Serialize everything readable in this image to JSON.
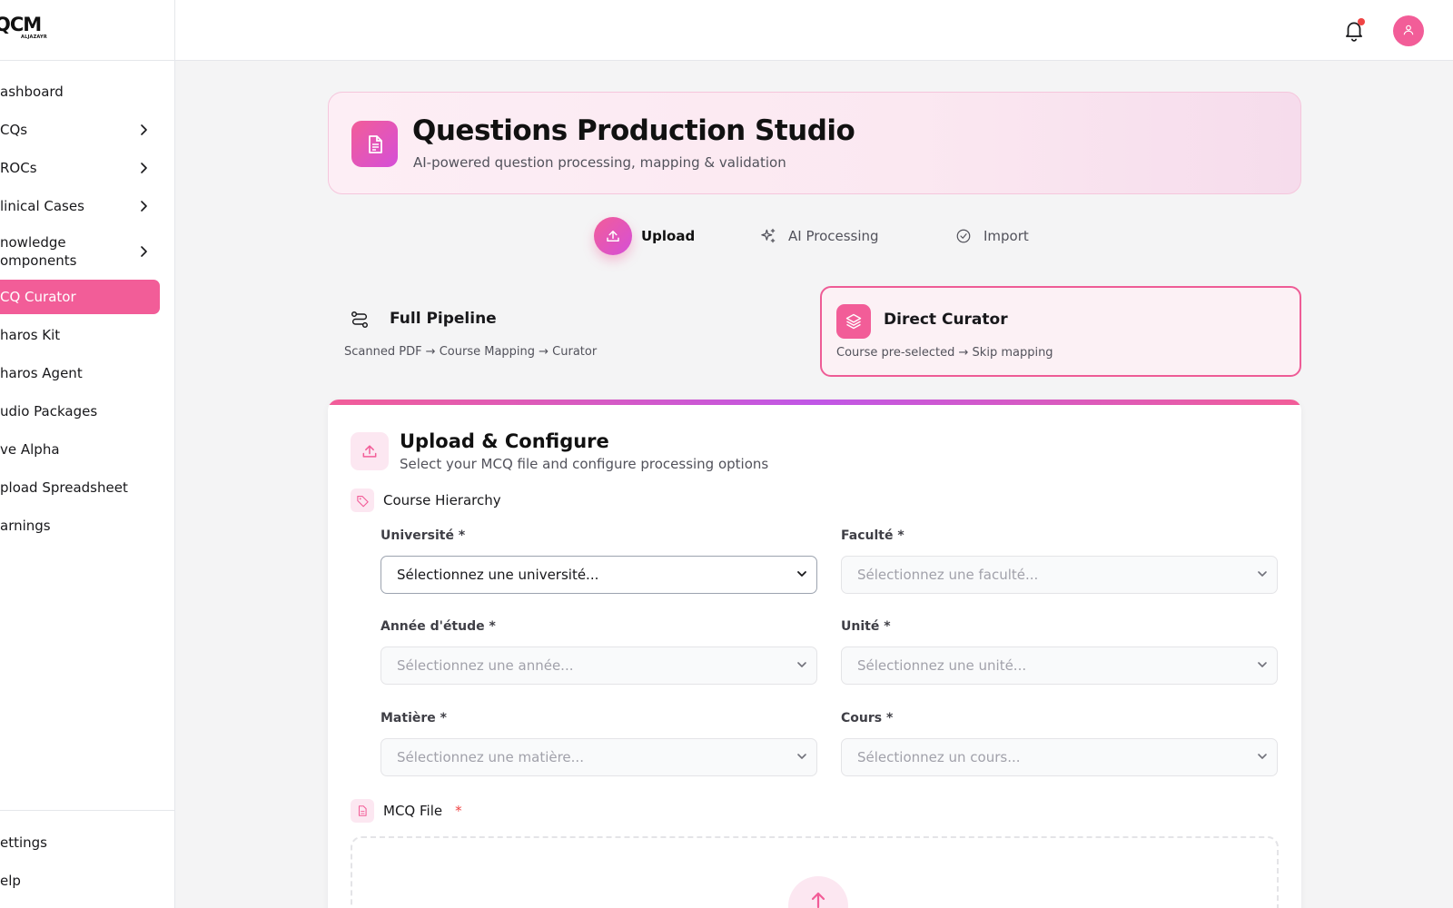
{
  "logo": {
    "main": "QCM",
    "sub": "ALJAZAYR"
  },
  "sidebar": {
    "items": [
      {
        "label": "ashboard",
        "chevron": false
      },
      {
        "label": "CQs",
        "chevron": true
      },
      {
        "label": "ROCs",
        "chevron": true
      },
      {
        "label": "linical Cases",
        "chevron": true
      },
      {
        "label": "nowledge\nomponents",
        "chevron": true
      },
      {
        "label": "CQ Curator",
        "chevron": false,
        "active": true
      },
      {
        "label": "haros Kit",
        "chevron": false
      },
      {
        "label": "haros Agent",
        "chevron": false
      },
      {
        "label": "udio Packages",
        "chevron": false
      },
      {
        "label": "ve Alpha",
        "chevron": false
      },
      {
        "label": "pload Spreadsheet",
        "chevron": false
      },
      {
        "label": "arnings",
        "chevron": false
      }
    ],
    "bottom": [
      {
        "label": "ettings"
      },
      {
        "label": "elp"
      }
    ]
  },
  "topbar": {
    "bell_icon": "bell-icon",
    "avatar_icon": "user-icon"
  },
  "header": {
    "title": "Questions Production Studio",
    "subtitle": "AI-powered question processing, mapping & validation",
    "icon": "document-icon"
  },
  "stepper": [
    {
      "label": "Upload",
      "icon": "upload-icon",
      "active": true
    },
    {
      "label": "AI Processing",
      "icon": "sparkles-icon",
      "active": false
    },
    {
      "label": "Import",
      "icon": "check-circle-icon",
      "active": false
    }
  ],
  "modes": {
    "full": {
      "title": "Full Pipeline",
      "desc": "Scanned PDF → Course Mapping → Curator",
      "icon": "workflow-icon"
    },
    "direct": {
      "title": "Direct Curator",
      "desc": "Course pre-selected → Skip mapping",
      "icon": "layers-icon",
      "selected": true
    }
  },
  "config": {
    "title": "Upload & Configure",
    "subtitle": "Select your MCQ file and configure processing options",
    "hierarchy_label": "Course Hierarchy",
    "file_label": "MCQ File",
    "required_mark": "*",
    "fields": {
      "universite": {
        "label": "Université *",
        "placeholder": "Sélectionnez une université..."
      },
      "faculte": {
        "label": "Faculté *",
        "placeholder": "Sélectionnez une faculté..."
      },
      "annee": {
        "label": "Année d'étude *",
        "placeholder": "Sélectionnez une année..."
      },
      "unite": {
        "label": "Unité *",
        "placeholder": "Sélectionnez une unité..."
      },
      "matiere": {
        "label": "Matière *",
        "placeholder": "Sélectionnez une matière..."
      },
      "cours": {
        "label": "Cours *",
        "placeholder": "Sélectionnez un cours..."
      }
    }
  },
  "colors": {
    "accent": "#f25d98",
    "accent_purple": "#d54fd8",
    "muted": "#52525b"
  }
}
